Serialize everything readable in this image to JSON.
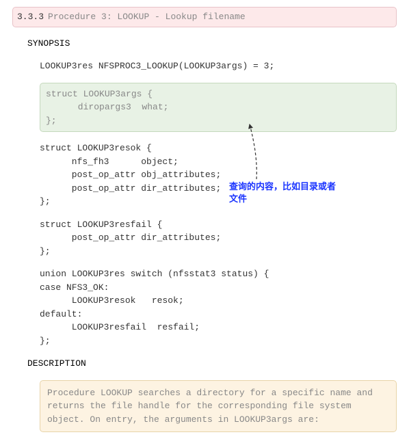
{
  "header": {
    "number": "3.3.3",
    "title": "Procedure 3: LOOKUP -  Lookup filename"
  },
  "synopsis_label": "SYNOPSIS",
  "signature": "LOOKUP3res NFSPROC3_LOOKUP(LOOKUP3args) = 3;",
  "args_struct": "struct LOOKUP3args {\n      diropargs3  what;\n};",
  "resok_struct": "struct LOOKUP3resok {\n      nfs_fh3      object;\n      post_op_attr obj_attributes;\n      post_op_attr dir_attributes;\n};",
  "resfail_struct": "struct LOOKUP3resfail {\n      post_op_attr dir_attributes;\n};",
  "union_def": "union LOOKUP3res switch (nfsstat3 status) {\ncase NFS3_OK:\n      LOOKUP3resok   resok;\ndefault:\n      LOOKUP3resfail  resfail;\n};",
  "description_label": "DESCRIPTION",
  "description_text": "Procedure LOOKUP searches a directory for a specific name and returns the file handle for the corresponding file system object. On entry, the arguments in LOOKUP3args are:",
  "annotation": "查询的内容，比如目录或者文件"
}
